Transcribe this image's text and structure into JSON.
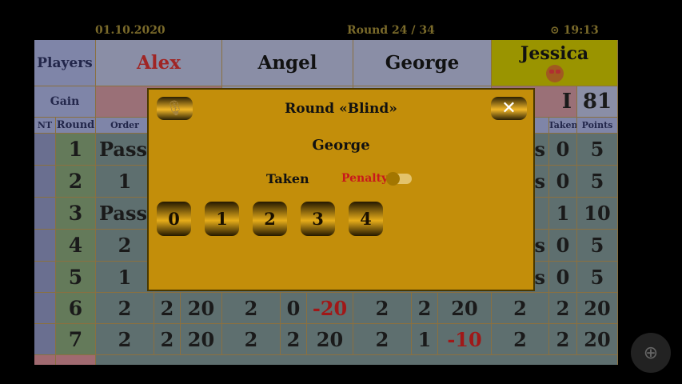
{
  "status_bar": {
    "date": "01.10.2020",
    "round": "Round 24 / 34",
    "time": "⊙ 19:13"
  },
  "header": {
    "players_label": "Players",
    "gain_label": "Gain",
    "nt_label": "NT",
    "round_label": "Round",
    "order_label": "Order",
    "taken_label": "Taken",
    "points_label": "Points"
  },
  "players": [
    {
      "name": "Alex",
      "gain": "I"
    },
    {
      "name": "Angel",
      "gain": ""
    },
    {
      "name": "George",
      "gain": ""
    },
    {
      "name": "Jessica",
      "gain": "81",
      "emoji": "star-struck-face"
    }
  ],
  "rows": [
    {
      "round": "1",
      "alex_order": "Pass",
      "jessica_tail": "s",
      "jessica_taken": "0",
      "jessica_points": "5"
    },
    {
      "round": "2",
      "alex_order": "1",
      "jessica_tail": "s",
      "jessica_taken": "0",
      "jessica_points": "5"
    },
    {
      "round": "3",
      "alex_order": "Pass",
      "jessica_tail": "",
      "jessica_taken": "1",
      "jessica_points": "10"
    },
    {
      "round": "4",
      "alex_order": "2",
      "jessica_tail": "s",
      "jessica_taken": "0",
      "jessica_points": "5"
    },
    {
      "round": "5",
      "alex_order": "1",
      "jessica_tail": "s",
      "jessica_taken": "0",
      "jessica_points": "5"
    },
    {
      "round": "6",
      "cells": [
        "2",
        "2",
        "20",
        "2",
        "0",
        "-20",
        "2",
        "2",
        "20",
        "2",
        "2",
        "20"
      ]
    },
    {
      "round": "7",
      "cells": [
        "2",
        "2",
        "20",
        "2",
        "2",
        "20",
        "2",
        "1",
        "-10",
        "2",
        "2",
        "20"
      ]
    }
  ],
  "modal": {
    "title": "Round «Blind»",
    "player": "George",
    "taken_label": "Taken",
    "penalty_label": "Penalty",
    "penalty_on": false,
    "close_glyph": "✕",
    "left_icon": "microphone-icon",
    "numbers": [
      "0",
      "1",
      "2",
      "3",
      "4"
    ]
  },
  "fab_glyph": "⊕"
}
